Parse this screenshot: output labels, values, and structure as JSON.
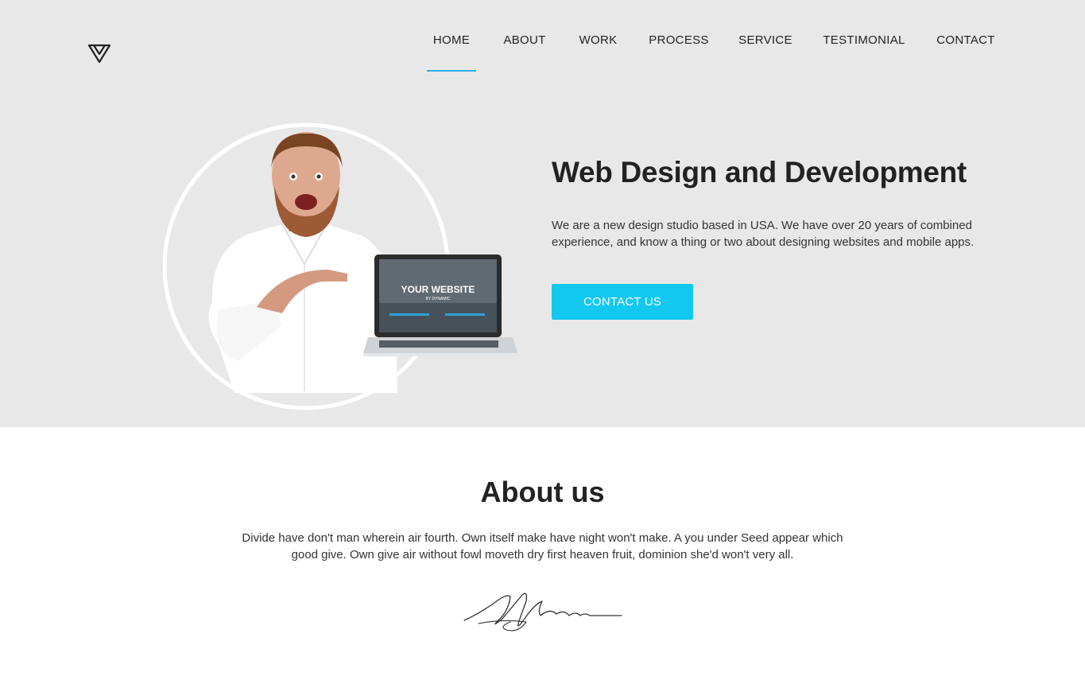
{
  "nav": {
    "items": [
      {
        "label": "HOME",
        "active": true
      },
      {
        "label": "ABOUT"
      },
      {
        "label": "WORK"
      },
      {
        "label": "PROCESS"
      },
      {
        "label": "SERVICE"
      },
      {
        "label": "TESTIMONIAL"
      },
      {
        "label": "CONTACT"
      }
    ]
  },
  "hero": {
    "title": "Web Design and Development",
    "text": "We are a new design studio based in USA. We have over 20 years of combined experience, and know a thing or two about designing websites and mobile apps.",
    "cta_label": "CONTACT US",
    "laptop_title": "YOUR WEBSITE",
    "laptop_subtitle": "BY DYNAMIC"
  },
  "about": {
    "title": "About us",
    "text": "Divide have don't man wherein air fourth. Own itself make have night won't make. A you under Seed appear which good give. Own give air without fowl moveth dry first heaven fruit, dominion she'd won't very all."
  },
  "colors": {
    "hero_bg": "#e8e8e8",
    "accent": "#12c8ef",
    "nav_underline": "#29aee6"
  }
}
